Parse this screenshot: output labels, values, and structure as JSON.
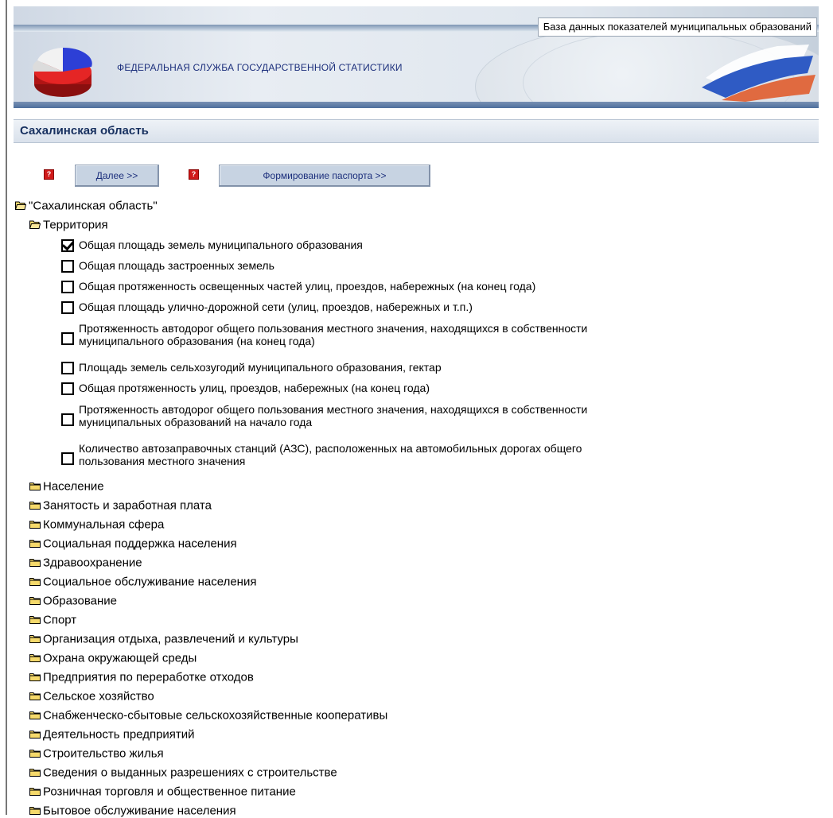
{
  "header": {
    "db_title": "База данных показателей муниципальных образований",
    "agency": "ФЕДЕРАЛЬНАЯ СЛУЖБА ГОСУДАРСТВЕННОЙ СТАТИСТИКИ"
  },
  "region": {
    "title": "Сахалинская область"
  },
  "toolbar": {
    "next_label": "Далее >>",
    "passport_label": "Формирование паспорта >>"
  },
  "tree": {
    "root_label": "\"Сахалинская область\"",
    "territory_label": "Территория",
    "indicators": [
      {
        "text": "Общая площадь земель муниципального образования",
        "checked": true
      },
      {
        "text": "Общая площадь застроенных земель",
        "checked": false
      },
      {
        "text": "Общая протяженность освещенных частей улиц, проездов, набережных (на конец года)",
        "checked": false
      },
      {
        "text": "Общая площадь улично-дорожной сети (улиц, проездов, набережных и т.п.)",
        "checked": false
      },
      {
        "line1": "Протяженность автодорог общего пользования местного значения, находящихся в собственности",
        "line2": "муниципального образования (на конец года)",
        "checked": false
      },
      {
        "text": "Площадь земель сельхозугодий муниципального образования, гектар",
        "checked": false
      },
      {
        "text": "Общая протяженность улиц, проездов, набережных (на конец года)",
        "checked": false
      },
      {
        "line1": "Протяженность автодорог общего пользования местного значения, находящихся в собственности",
        "line2": "муниципальных образований на начало года",
        "checked": false
      },
      {
        "line1": "Количество автозаправочных станций (АЗС), расположенных на автомобильных дорогах общего",
        "line2": "пользования местного значения",
        "checked": false
      }
    ],
    "categories": [
      "Население",
      "Занятость и заработная плата",
      "Коммунальная сфера",
      "Социальная поддержка населения",
      "Здравоохранение",
      "Социальное обслуживание населения",
      "Образование",
      "Спорт",
      "Организация отдыха, развлечений и культуры",
      "Охрана окружающей среды",
      "Предприятия по переработке отходов",
      "Сельское хозяйство",
      "Снабженческо-сбытовые сельскохозяйственные кооперативы",
      "Деятельность предприятий",
      "Строительство жилья",
      "Сведения о выданных разрешениях с строительстве",
      "Розничная торговля и общественное питание",
      "Бытовое обслуживание населения"
    ]
  }
}
